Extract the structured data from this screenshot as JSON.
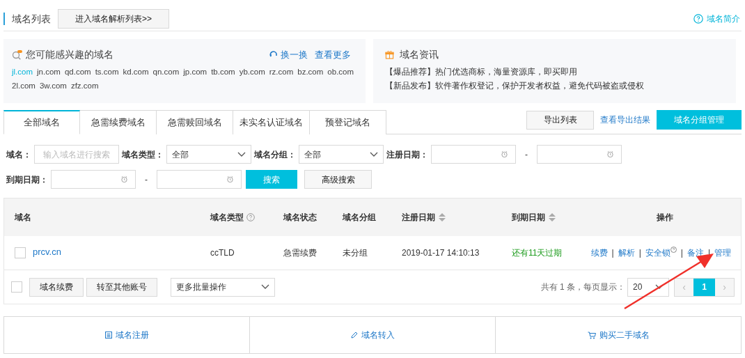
{
  "header": {
    "title": "域名列表",
    "parse_button": "进入域名解析列表>>",
    "help_link": "域名简介"
  },
  "interest": {
    "title": "您可能感兴趣的域名",
    "swap_link": "换一换",
    "more_link": "查看更多",
    "domains": [
      {
        "text": "jl.com",
        "selected": true
      },
      {
        "text": "jn.com",
        "selected": false
      },
      {
        "text": "qd.com",
        "selected": false
      },
      {
        "text": "ts.com",
        "selected": false
      },
      {
        "text": "kd.com",
        "selected": false
      },
      {
        "text": "qn.com",
        "selected": false
      },
      {
        "text": "jp.com",
        "selected": false
      },
      {
        "text": "tb.com",
        "selected": false
      },
      {
        "text": "yb.com",
        "selected": false
      },
      {
        "text": "rz.com",
        "selected": false
      },
      {
        "text": "bz.com",
        "selected": false
      },
      {
        "text": "ob.com",
        "selected": false
      },
      {
        "text": "2l.com",
        "selected": false
      },
      {
        "text": "3w.com",
        "selected": false
      },
      {
        "text": "zfz.com",
        "selected": false
      }
    ]
  },
  "news": {
    "title": "域名资讯",
    "items": [
      {
        "tag": "【爆品推荐】",
        "text": "热门优选商标，海量资源库，即买即用"
      },
      {
        "tag": "【新品发布】",
        "text": "软件著作权登记，保护开发者权益，避免代码被盗或侵权"
      }
    ]
  },
  "tabs": [
    {
      "label": "全部域名",
      "selected": true
    },
    {
      "label": "急需续费域名",
      "selected": false
    },
    {
      "label": "急需赎回域名",
      "selected": false
    },
    {
      "label": "未实名认证域名",
      "selected": false
    },
    {
      "label": "预登记域名",
      "selected": false
    }
  ],
  "toolbar": {
    "export_button": "导出列表",
    "export_result_link": "查看导出结果",
    "group_button": "域名分组管理"
  },
  "filters": {
    "separator": "-",
    "rows": [
      [
        {
          "kind": "text",
          "label": "域名：",
          "placeholder": "输入域名进行搜索"
        },
        {
          "kind": "select",
          "label": "域名类型：",
          "value": "全部"
        },
        {
          "kind": "select",
          "label": "域名分组：",
          "value": "全部"
        },
        {
          "kind": "date_range",
          "label": "注册日期："
        }
      ],
      [
        {
          "kind": "date_range",
          "label": "到期日期："
        }
      ]
    ],
    "search_button": "搜索",
    "advanced_button": "高级搜索"
  },
  "table": {
    "separator": "|",
    "columns": [
      {
        "label": "域名",
        "kind": "plain"
      },
      {
        "label": "域名类型",
        "kind": "help"
      },
      {
        "label": "域名状态",
        "kind": "plain"
      },
      {
        "label": "域名分组",
        "kind": "plain"
      },
      {
        "label": "注册日期",
        "kind": "sortable"
      },
      {
        "label": "到期日期",
        "kind": "sortable"
      },
      {
        "label": "操作",
        "kind": "plain"
      }
    ],
    "rows": [
      {
        "checked": false,
        "domain": "prcv.cn",
        "type": "ccTLD",
        "status": "急需续费",
        "group": "未分组",
        "registered": "2019-01-17 14:10:13",
        "expiry": "还有11天过期",
        "actions": [
          {
            "label": "续费",
            "kind": "plain"
          },
          {
            "label": "解析",
            "kind": "plain"
          },
          {
            "label": "安全锁",
            "kind": "help"
          },
          {
            "label": "备注",
            "kind": "plain"
          },
          {
            "label": "管理",
            "kind": "plain"
          }
        ]
      }
    ]
  },
  "footer": {
    "select_all_checked": false,
    "buttons": [
      "域名续费",
      "转至其他账号"
    ],
    "batch_select": "更多批量操作",
    "total": "共有 1 条，每页显示：",
    "page_size": "20",
    "prev": "‹",
    "next": "›",
    "pages": [
      {
        "label": "1",
        "selected": true
      }
    ]
  },
  "bottom_links": [
    {
      "kind": "register",
      "label": "域名注册"
    },
    {
      "kind": "transfer",
      "label": "域名转入"
    },
    {
      "kind": "buy",
      "label": "购买二手域名"
    }
  ]
}
